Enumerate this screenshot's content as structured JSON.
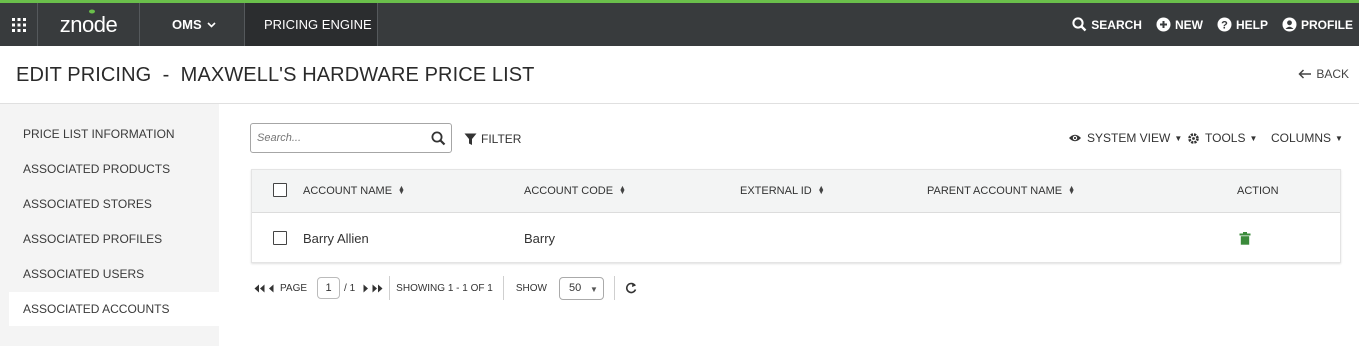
{
  "nav": {
    "logo": "znode",
    "oms": "OMS",
    "pricing_engine": "PRICING ENGINE",
    "search": "SEARCH",
    "new": "NEW",
    "help": "HELP",
    "profile": "PROFILE",
    "accent_color": "#6abf4b"
  },
  "header": {
    "title": "EDIT PRICING  -  MAXWELL'S HARDWARE PRICE LIST",
    "back": "BACK"
  },
  "sidebar": {
    "items": [
      {
        "label": "PRICE LIST INFORMATION"
      },
      {
        "label": "ASSOCIATED PRODUCTS"
      },
      {
        "label": "ASSOCIATED STORES"
      },
      {
        "label": "ASSOCIATED PROFILES"
      },
      {
        "label": "ASSOCIATED USERS"
      },
      {
        "label": "ASSOCIATED ACCOUNTS"
      }
    ],
    "active_index": 5
  },
  "toolbar": {
    "search_placeholder": "Search...",
    "filter": "FILTER",
    "system_view": "SYSTEM VIEW",
    "tools": "TOOLS",
    "columns": "COLUMNS"
  },
  "table": {
    "headers": [
      "ACCOUNT NAME",
      "ACCOUNT CODE",
      "EXTERNAL ID",
      "PARENT ACCOUNT NAME",
      "ACTION"
    ],
    "rows": [
      {
        "account_name": "Barry Allien",
        "account_code": "Barry",
        "external_id": "",
        "parent_account_name": ""
      }
    ],
    "delete_color": "#3a8a3a"
  },
  "pager": {
    "page_label": "PAGE",
    "current_page": "1",
    "total_pages": "/ 1",
    "showing": "SHOWING 1 - 1 OF 1",
    "show_label": "SHOW",
    "page_size": "50"
  }
}
